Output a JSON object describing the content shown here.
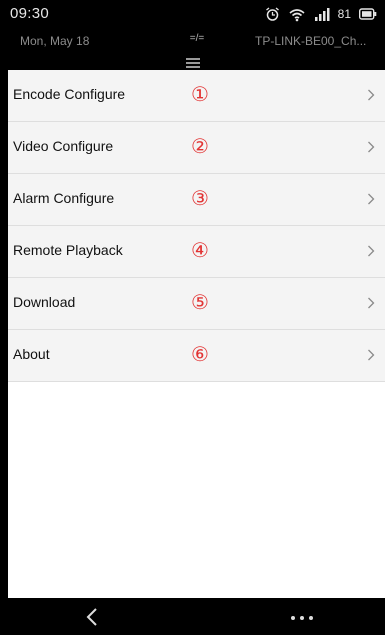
{
  "status_bar": {
    "time": "09:30",
    "battery_level": "81",
    "icons": [
      "alarm-icon",
      "wifi-icon",
      "signal-icon",
      "battery-icon"
    ]
  },
  "notification": {
    "date": "Mon, May 18",
    "toggle_label": "=/=",
    "wifi_name": "TP-LINK-BE00_Ch..."
  },
  "menu": {
    "items": [
      {
        "label": "Encode Configure",
        "number": "①"
      },
      {
        "label": "Video Configure",
        "number": "②"
      },
      {
        "label": "Alarm Configure",
        "number": "③"
      },
      {
        "label": "Remote Playback",
        "number": "④"
      },
      {
        "label": "Download",
        "number": "⑤"
      },
      {
        "label": "About",
        "number": "⑥"
      }
    ]
  },
  "bottom_nav": {
    "icons": [
      "back-icon",
      "more-icon"
    ]
  },
  "colors": {
    "annotation": "#e23434",
    "background": "#000000",
    "list_background": "#f4f4f4"
  }
}
